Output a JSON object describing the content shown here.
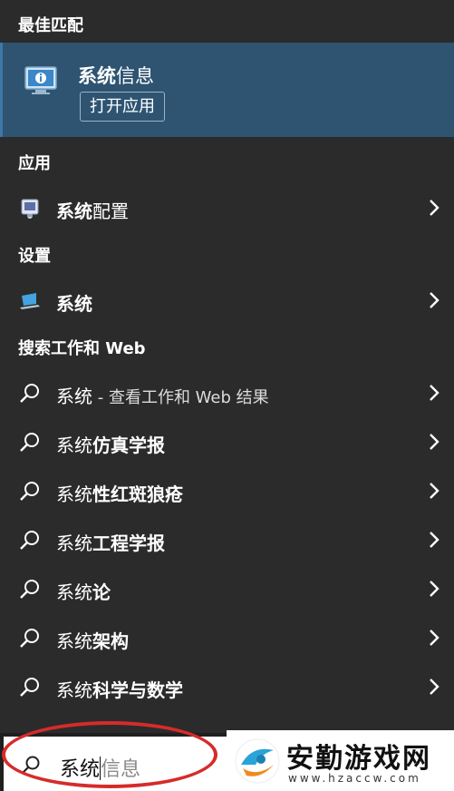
{
  "sections": {
    "best_match": "最佳匹配",
    "apps": "应用",
    "settings": "设置",
    "web": "搜索工作和 Web"
  },
  "best_match": {
    "title_bold": "系统",
    "title_rest": "信息",
    "open_label": "打开应用"
  },
  "apps": [
    {
      "bold": "系统",
      "rest": "配置"
    }
  ],
  "settings": [
    {
      "bold": "系统",
      "rest": ""
    }
  ],
  "web": [
    {
      "bold": "系统",
      "rest": "",
      "hint": " - 查看工作和 Web 结果"
    },
    {
      "bold": "",
      "plain": "系统",
      "rest": "仿真学报"
    },
    {
      "bold": "",
      "plain": "系统",
      "rest": "性红斑狼疮"
    },
    {
      "bold": "",
      "plain": "系统",
      "rest": "工程学报"
    },
    {
      "bold": "",
      "plain": "系统",
      "rest": "论"
    },
    {
      "bold": "",
      "plain": "系统",
      "rest": "架构"
    },
    {
      "bold": "",
      "plain": "系统",
      "rest": "科学与数学"
    }
  ],
  "search": {
    "typed": "系统",
    "suggestion": "信息"
  },
  "watermark": {
    "name": "安勤游戏网",
    "url": "www.hzaccw.com"
  },
  "colors": {
    "background": "#2b2b2b",
    "highlight": "#2e5472",
    "annotation": "#d62b2b"
  }
}
